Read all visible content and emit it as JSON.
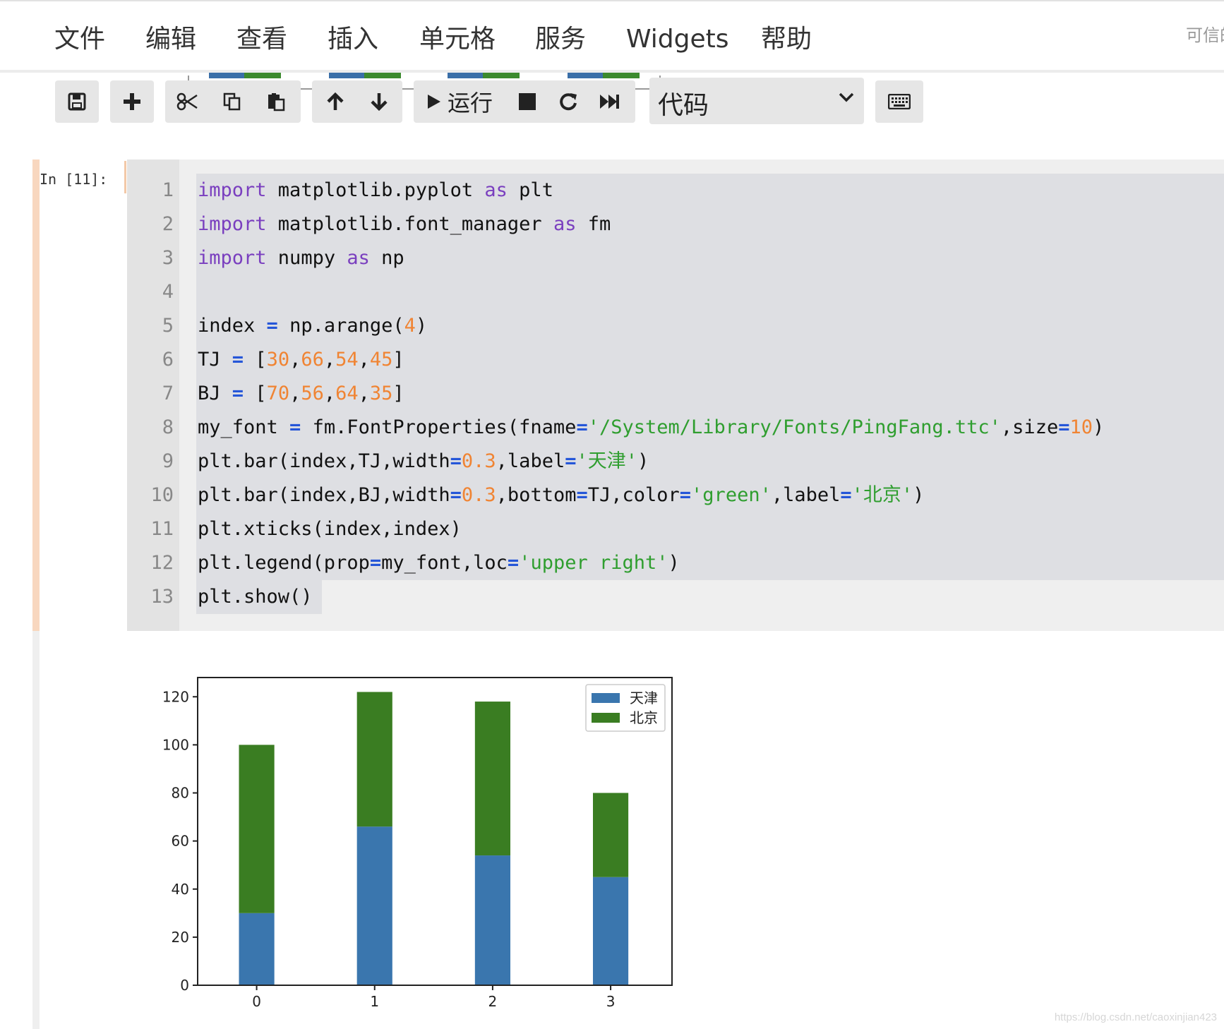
{
  "menu": {
    "items": [
      "文件",
      "编辑",
      "查看",
      "插入",
      "单元格",
      "服务",
      "Widgets",
      "帮助"
    ],
    "trusted": "可信的"
  },
  "toolbar": {
    "run_label": "运行",
    "cell_type": "代码",
    "icons": [
      "save-icon",
      "plus-icon",
      "cut-icon",
      "copy-icon",
      "paste-icon",
      "arrow-up-icon",
      "arrow-down-icon",
      "run-icon",
      "stop-icon",
      "restart-icon",
      "fast-forward-icon",
      "chevron-down-icon",
      "keyboard-icon"
    ]
  },
  "cell": {
    "prompt": "In [11]:",
    "line_numbers": [
      "1",
      "2",
      "3",
      "4",
      "5",
      "6",
      "7",
      "8",
      "9",
      "10",
      "11",
      "12",
      "13"
    ],
    "code": [
      [
        [
          "kw",
          "import"
        ],
        [
          "",
          " matplotlib.pyplot "
        ],
        [
          "kw",
          "as"
        ],
        [
          "",
          " plt"
        ]
      ],
      [
        [
          "kw",
          "import"
        ],
        [
          "",
          " matplotlib.font_manager "
        ],
        [
          "kw",
          "as"
        ],
        [
          "",
          " fm"
        ]
      ],
      [
        [
          "kw",
          "import"
        ],
        [
          "",
          " numpy "
        ],
        [
          "kw",
          "as"
        ],
        [
          "",
          " np"
        ]
      ],
      [],
      [
        [
          "",
          "index "
        ],
        [
          "op",
          "="
        ],
        [
          "",
          " np.arange("
        ],
        [
          "num",
          "4"
        ],
        [
          "",
          ")"
        ]
      ],
      [
        [
          "",
          "TJ "
        ],
        [
          "op",
          "="
        ],
        [
          "",
          " ["
        ],
        [
          "num",
          "30"
        ],
        [
          "",
          ","
        ],
        [
          "num",
          "66"
        ],
        [
          "",
          ","
        ],
        [
          "num",
          "54"
        ],
        [
          "",
          ","
        ],
        [
          "num",
          "45"
        ],
        [
          "",
          "]"
        ]
      ],
      [
        [
          "",
          "BJ "
        ],
        [
          "op",
          "="
        ],
        [
          "",
          " ["
        ],
        [
          "num",
          "70"
        ],
        [
          "",
          ","
        ],
        [
          "num",
          "56"
        ],
        [
          "",
          ","
        ],
        [
          "num",
          "64"
        ],
        [
          "",
          ","
        ],
        [
          "num",
          "35"
        ],
        [
          "",
          "]"
        ]
      ],
      [
        [
          "",
          "my_font "
        ],
        [
          "op",
          "="
        ],
        [
          "",
          " fm.FontProperties(fname"
        ],
        [
          "op",
          "="
        ],
        [
          "str",
          "'/System/Library/Fonts/PingFang.ttc'"
        ],
        [
          "",
          ",size"
        ],
        [
          "op",
          "="
        ],
        [
          "num",
          "10"
        ],
        [
          "",
          ")"
        ]
      ],
      [
        [
          "",
          "plt.bar(index,TJ,width"
        ],
        [
          "op",
          "="
        ],
        [
          "num",
          "0.3"
        ],
        [
          "",
          ",label"
        ],
        [
          "op",
          "="
        ],
        [
          "str",
          "'天津'"
        ],
        [
          "",
          ")"
        ]
      ],
      [
        [
          "",
          "plt.bar(index,BJ,width"
        ],
        [
          "op",
          "="
        ],
        [
          "num",
          "0.3"
        ],
        [
          "",
          ",bottom"
        ],
        [
          "op",
          "="
        ],
        [
          "",
          "TJ,color"
        ],
        [
          "op",
          "="
        ],
        [
          "str",
          "'green'"
        ],
        [
          "",
          ",label"
        ],
        [
          "op",
          "="
        ],
        [
          "str",
          "'北京'"
        ],
        [
          "",
          ")"
        ]
      ],
      [
        [
          "",
          "plt.xticks(index,index)"
        ]
      ],
      [
        [
          "",
          "plt.legend(prop"
        ],
        [
          "op",
          "="
        ],
        [
          "",
          "my_font,loc"
        ],
        [
          "op",
          "="
        ],
        [
          "str",
          "'upper right'"
        ],
        [
          "",
          ")"
        ]
      ],
      [
        [
          "",
          "plt.show()"
        ]
      ]
    ]
  },
  "chart_data": {
    "type": "bar",
    "stacked": true,
    "categories": [
      "0",
      "1",
      "2",
      "3"
    ],
    "series": [
      {
        "name": "天津",
        "values": [
          30,
          66,
          54,
          45
        ],
        "color": "#3a76ae"
      },
      {
        "name": "北京",
        "values": [
          70,
          56,
          64,
          35
        ],
        "color": "#3a7d22"
      }
    ],
    "yticks": [
      "0",
      "20",
      "40",
      "60",
      "80",
      "100",
      "120"
    ],
    "ylim": [
      0,
      128
    ],
    "legend": "upper right",
    "grid": false
  },
  "watermark": "https://blog.csdn.net/caoxinjian423"
}
